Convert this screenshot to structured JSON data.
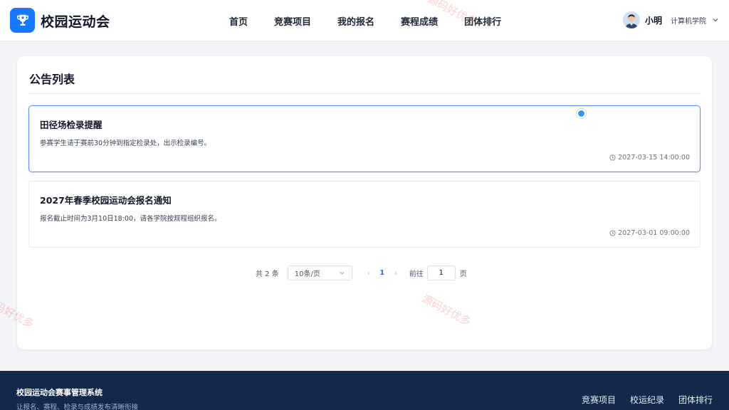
{
  "header": {
    "app_title": "校园运动会",
    "logo_icon": "trophy-icon",
    "nav": [
      "首页",
      "竞赛项目",
      "我的报名",
      "赛程成绩",
      "团体排行"
    ],
    "user": {
      "name": "小明",
      "college": "计算机学院"
    }
  },
  "main": {
    "title": "公告列表",
    "notices": [
      {
        "title": "田径场检录提醒",
        "body": "参赛学生请于赛前30分钟到指定检录处，出示检录编号。",
        "time": "2027-03-15 14:00:00"
      },
      {
        "title": "2027年春季校园运动会报名通知",
        "body": "报名截止时间为3月10日18:00，请各学院按规程组织报名。",
        "time": "2027-03-01 09:00:00"
      }
    ],
    "pagination": {
      "total_text": "共 2 条",
      "page_size": "10条/页",
      "current_page": "1",
      "goto_label": "前往",
      "goto_value": "1",
      "page_suffix": "页"
    }
  },
  "watermark": "源码好优多",
  "footer": {
    "title": "校园运动会赛事管理系统",
    "subtitle": "让报名、赛程、检录与成绩发布清晰衔接",
    "links": [
      "竞赛项目",
      "校运纪录",
      "团体排行"
    ]
  },
  "colors": {
    "accent": "#1677ff",
    "footer_bg": "#13284a",
    "active_border": "#5b8ff9"
  }
}
